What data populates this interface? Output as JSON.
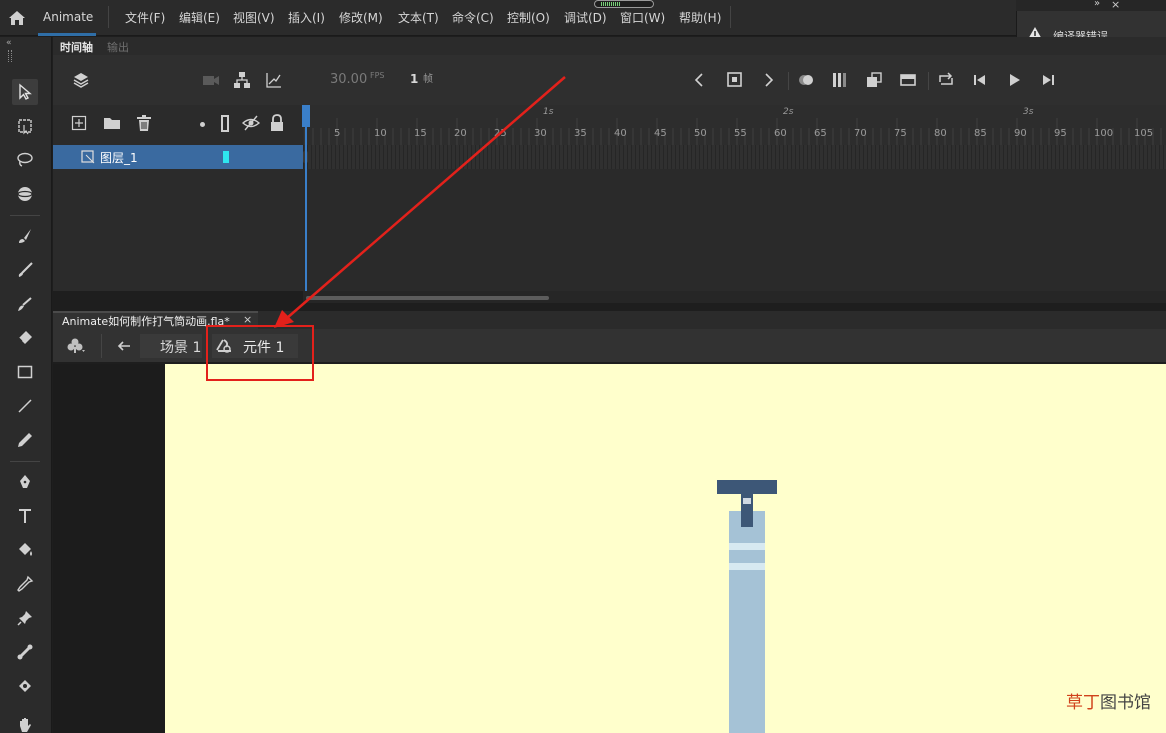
{
  "app": {
    "name": "Animate",
    "menu": [
      "文件(F)",
      "编辑(E)",
      "视图(V)",
      "插入(I)",
      "修改(M)",
      "文本(T)",
      "命令(C)",
      "控制(O)",
      "调试(D)",
      "窗口(W)",
      "帮助(H)"
    ],
    "accent_color": "#2f6ea7"
  },
  "compiler_panel": {
    "title": "编译器错误",
    "icon": "warning-icon"
  },
  "timeline": {
    "tabs": [
      "时间轴",
      "输出"
    ],
    "fps": "30.00",
    "fps_unit": "FPS",
    "current_frame": "1",
    "frame_unit": "帧",
    "layer": {
      "name": "图层_1",
      "color": "#3a6aa0",
      "marker_color": "#2ee6f0"
    },
    "ruler_numbers": [
      "5",
      "10",
      "15",
      "20",
      "25",
      "30",
      "35",
      "40",
      "45",
      "50",
      "55",
      "60",
      "65",
      "70",
      "75",
      "80",
      "85",
      "90",
      "95",
      "100",
      "105"
    ],
    "ruler_seconds": [
      "1s",
      "2s",
      "3s"
    ]
  },
  "document": {
    "tab_title": "Animate如何制作打气筒动画.fla*",
    "tab_close": "×",
    "scene_label": "场景 1",
    "symbol_label": "元件 1",
    "stage_color": "#ffffcc",
    "highlight_color": "#e3211b"
  },
  "watermark": {
    "part1": "草丁",
    "part2": "图书馆"
  }
}
